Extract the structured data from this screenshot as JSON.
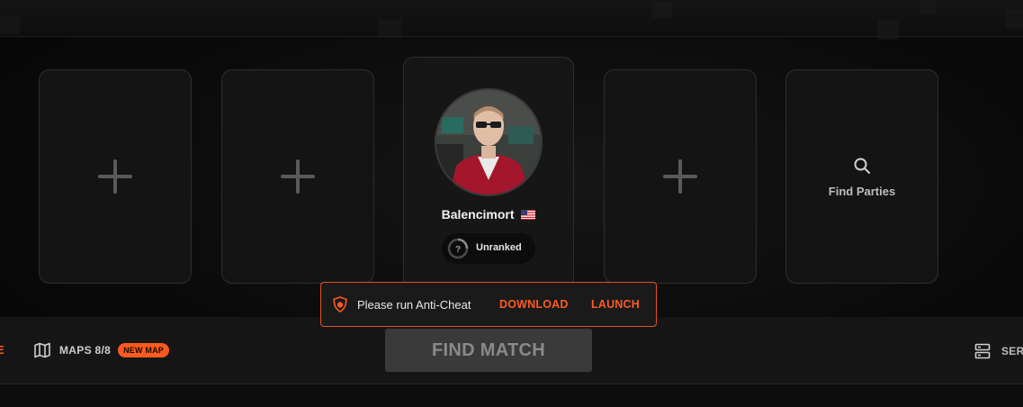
{
  "party_slots": [
    {
      "type": "empty"
    },
    {
      "type": "empty"
    },
    {
      "type": "player"
    },
    {
      "type": "empty"
    }
  ],
  "player": {
    "name": "Balencimort",
    "country": "US",
    "rank_label": "Unranked",
    "rank_icon": "?"
  },
  "find_parties": {
    "label": "Find Parties",
    "icon": "search-icon"
  },
  "anticheat": {
    "message": "Please run Anti-Cheat",
    "download_label": "DOWNLOAD",
    "launch_label": "LAUNCH",
    "icon": "shield-icon"
  },
  "bottom_bar": {
    "left_cut_text": "E",
    "maps_label": "MAPS 8/8",
    "new_map_badge": "NEW MAP",
    "find_match_label": "FIND MATCH",
    "servers_label": "SER"
  },
  "colors": {
    "accent": "#ff5a1f",
    "card_bg": "#141414",
    "button_disabled": "#3a3a3a"
  }
}
